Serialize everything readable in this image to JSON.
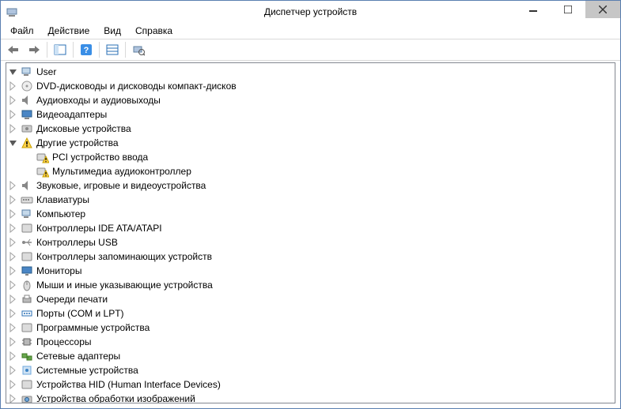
{
  "window": {
    "title": "Диспетчер устройств"
  },
  "menu": {
    "file": "Файл",
    "action": "Действие",
    "view": "Вид",
    "help": "Справка"
  },
  "tree": {
    "root": {
      "label": "User"
    },
    "nodes": [
      {
        "id": "dvd",
        "label": "DVD-дисководы и дисководы компакт-дисков",
        "icon": "dvd-icon",
        "state": "collapsed"
      },
      {
        "id": "audio-io",
        "label": "Аудиовходы и аудиовыходы",
        "icon": "speaker-icon",
        "state": "collapsed"
      },
      {
        "id": "video",
        "label": "Видеоадаптеры",
        "icon": "display-icon",
        "state": "collapsed"
      },
      {
        "id": "disk",
        "label": "Дисковые устройства",
        "icon": "disk-icon",
        "state": "collapsed"
      },
      {
        "id": "other",
        "label": "Другие устройства",
        "icon": "warning-icon",
        "state": "expanded",
        "children": [
          {
            "id": "pci-input",
            "label": "PCI устройство ввода",
            "icon": "warning-device-icon"
          },
          {
            "id": "mm-audio",
            "label": "Мультимедиа аудиоконтроллер",
            "icon": "warning-device-icon"
          }
        ]
      },
      {
        "id": "sound",
        "label": "Звуковые, игровые и видеоустройства",
        "icon": "speaker-icon",
        "state": "collapsed"
      },
      {
        "id": "keyboard",
        "label": "Клавиатуры",
        "icon": "keyboard-icon",
        "state": "collapsed"
      },
      {
        "id": "computer",
        "label": "Компьютер",
        "icon": "computer-icon",
        "state": "collapsed"
      },
      {
        "id": "ide",
        "label": "Контроллеры IDE ATA/ATAPI",
        "icon": "ide-icon",
        "state": "collapsed"
      },
      {
        "id": "usb",
        "label": "Контроллеры USB",
        "icon": "usb-icon",
        "state": "collapsed"
      },
      {
        "id": "storage",
        "label": "Контроллеры запоминающих устройств",
        "icon": "storage-icon",
        "state": "collapsed"
      },
      {
        "id": "monitors",
        "label": "Мониторы",
        "icon": "monitor-icon",
        "state": "collapsed"
      },
      {
        "id": "mice",
        "label": "Мыши и иные указывающие устройства",
        "icon": "mouse-icon",
        "state": "collapsed"
      },
      {
        "id": "printq",
        "label": "Очереди печати",
        "icon": "printer-icon",
        "state": "collapsed"
      },
      {
        "id": "ports",
        "label": "Порты (COM и LPT)",
        "icon": "port-icon",
        "state": "collapsed"
      },
      {
        "id": "software",
        "label": "Программные устройства",
        "icon": "software-icon",
        "state": "collapsed"
      },
      {
        "id": "cpu",
        "label": "Процессоры",
        "icon": "cpu-icon",
        "state": "collapsed"
      },
      {
        "id": "network",
        "label": "Сетевые адаптеры",
        "icon": "network-icon",
        "state": "collapsed"
      },
      {
        "id": "system",
        "label": "Системные устройства",
        "icon": "system-icon",
        "state": "collapsed"
      },
      {
        "id": "hid",
        "label": "Устройства HID (Human Interface Devices)",
        "icon": "hid-icon",
        "state": "collapsed"
      },
      {
        "id": "imaging",
        "label": "Устройства обработки изображений",
        "icon": "imaging-icon",
        "state": "collapsed"
      }
    ]
  }
}
